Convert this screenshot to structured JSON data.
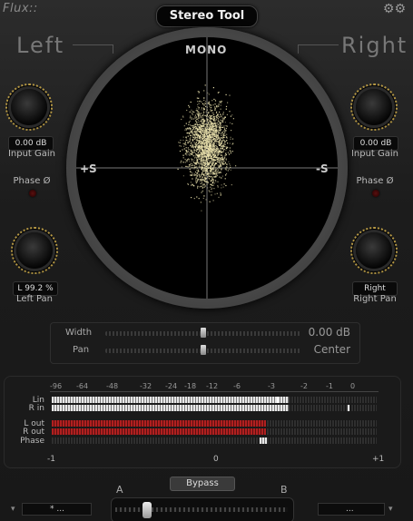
{
  "header": {
    "brand": "Flux::",
    "title": "Stereo Tool"
  },
  "icons": {
    "settings": "gear-icon"
  },
  "left": {
    "label": "Left",
    "input_gain": "0.00 dB",
    "input_gain_label": "Input Gain",
    "phase_label": "Phase Ø",
    "pan_value": "L 99.2 %",
    "pan_label": "Left Pan"
  },
  "right": {
    "label": "Right",
    "input_gain": "0.00 dB",
    "input_gain_label": "Input Gain",
    "phase_label": "Phase Ø",
    "pan_value": "Right",
    "pan_label": "Right Pan"
  },
  "scope": {
    "top": "MONO",
    "left": "+S",
    "right": "-S"
  },
  "sliders": {
    "width_label": "Width",
    "width_value": "0.00 dB",
    "width_position": 0.5,
    "pan_label": "Pan",
    "pan_value": "Center",
    "pan_position": 0.5
  },
  "meters": {
    "scale": [
      "-96",
      "-64",
      "-48",
      "-32",
      "-24",
      "-18",
      "-12",
      "-6",
      "-3",
      "-2",
      "-1",
      "0"
    ],
    "rows": [
      {
        "label": "Lin",
        "level": 0.73
      },
      {
        "label": "R in",
        "level": 0.73
      },
      {
        "label": "L out",
        "level": 0.66
      },
      {
        "label": "R out",
        "level": 0.66
      },
      {
        "label": "Phase",
        "level": 0.5
      }
    ],
    "phase_scale": [
      "-1",
      "0",
      "+1"
    ]
  },
  "footer": {
    "bypass": "Bypass",
    "a": "A",
    "b": "B",
    "preset_left": "* ...",
    "preset_right": "..."
  },
  "colors": {
    "accent_gold": "#b89a44",
    "scope_dots": "#efe6b0",
    "meter_red": "#b02020"
  }
}
